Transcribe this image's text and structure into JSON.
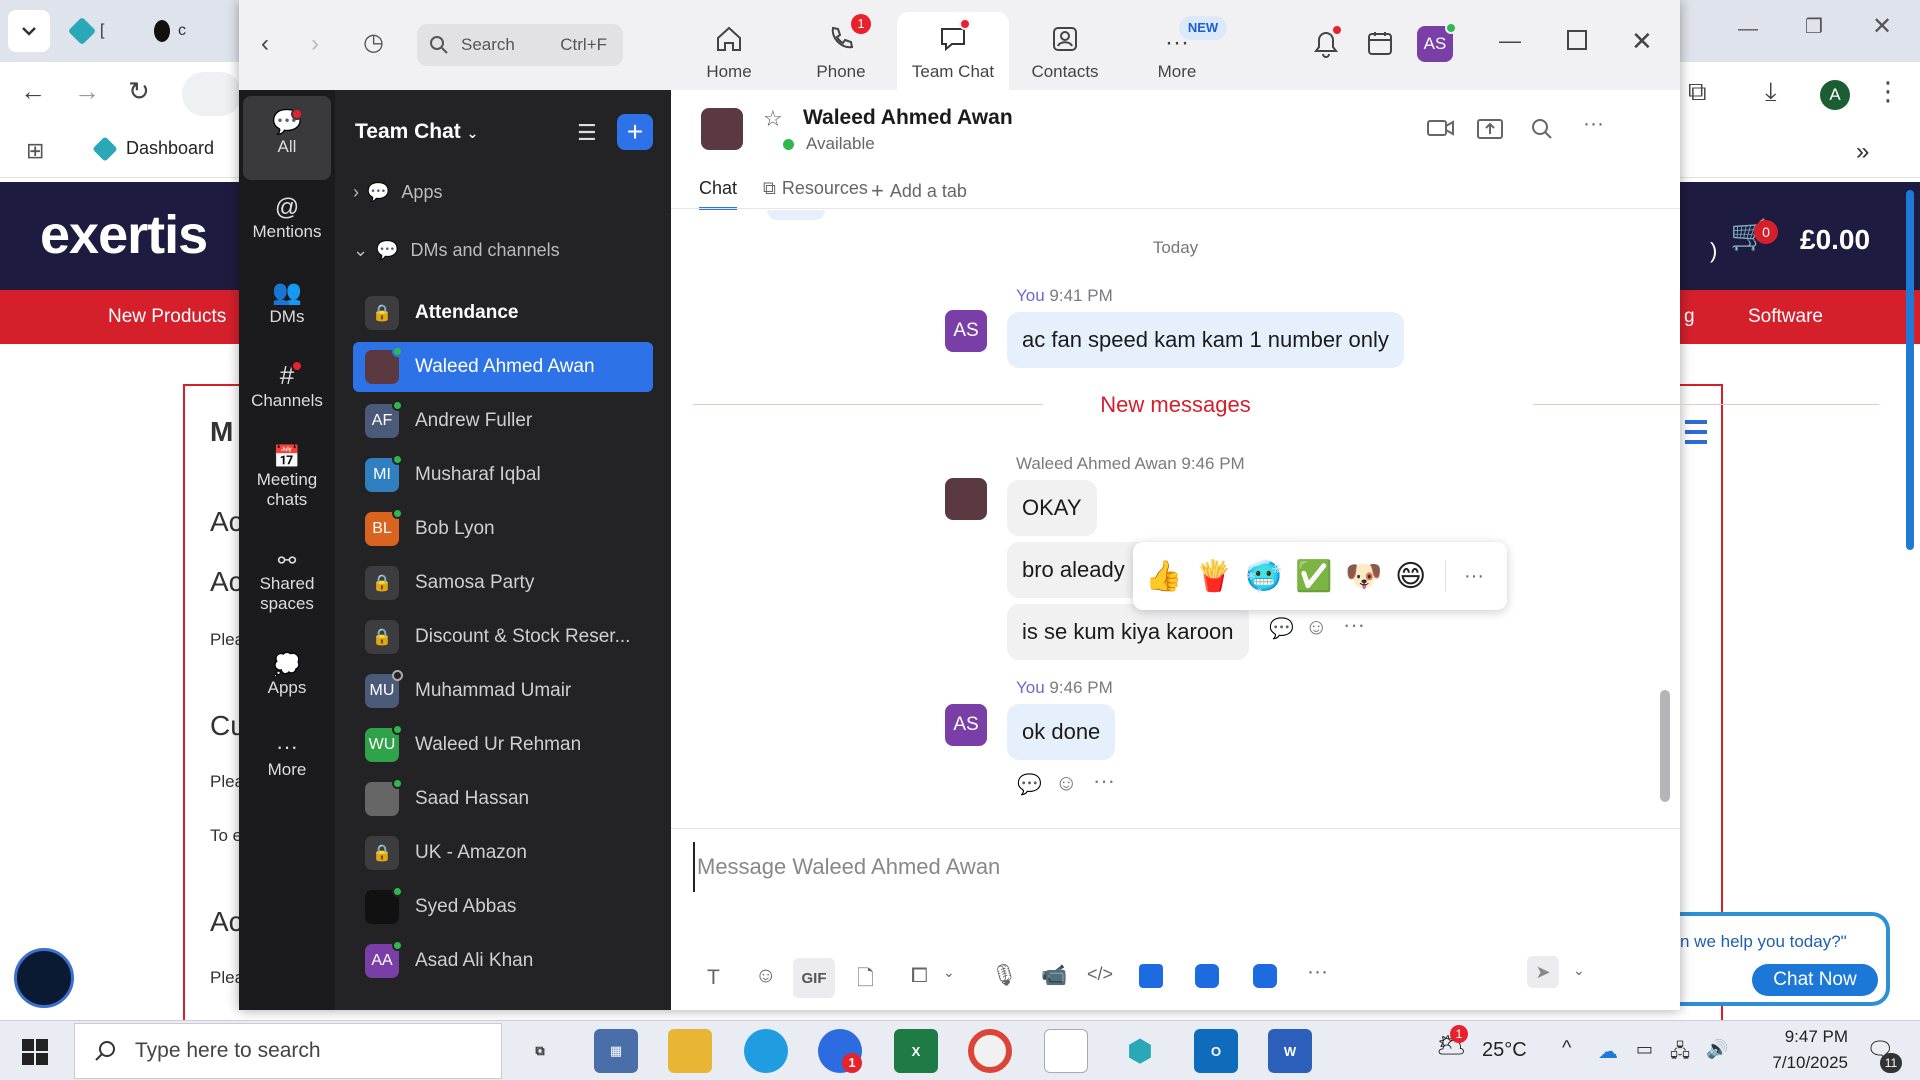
{
  "browser": {
    "tabs": [
      {
        "label": "[",
        "icon": "site-icon"
      },
      {
        "label": "c",
        "icon": "site-icon"
      }
    ],
    "bookmark_dashboard": "Dashboard",
    "profile_initial": "A"
  },
  "site": {
    "brand": "exertis",
    "cart_count": "0",
    "cart_total": "£0.00",
    "nav": [
      "New Products",
      "g",
      "Software"
    ],
    "fragments": [
      "M",
      "Ac",
      "Ac",
      "Plea",
      "Cu",
      "Plea",
      "To e",
      "Ac",
      "Plea"
    ],
    "paren": ")",
    "chat_prompt": "n we help you today?\"",
    "chat_now": "Chat Now"
  },
  "zoom": {
    "search_placeholder": "Search",
    "search_shortcut": "Ctrl+F",
    "tabs": [
      {
        "label": "Home",
        "icon": "home-icon"
      },
      {
        "label": "Phone",
        "icon": "phone-icon",
        "badge": "1"
      },
      {
        "label": "Team Chat",
        "icon": "chat-icon"
      },
      {
        "label": "Contacts",
        "icon": "contacts-icon"
      },
      {
        "label": "More",
        "icon": "more-icon",
        "badge": "NEW"
      }
    ],
    "user_initials": "AS",
    "rail": [
      {
        "label": "All"
      },
      {
        "label": "Mentions"
      },
      {
        "label": "DMs"
      },
      {
        "label": "Channels"
      },
      {
        "label": "Meeting chats"
      },
      {
        "label": "Shared spaces"
      },
      {
        "label": "Apps"
      },
      {
        "label": "More"
      }
    ],
    "sidebar": {
      "title": "Team Chat",
      "sections": [
        "Apps",
        "DMs and channels"
      ],
      "channels": [
        {
          "label": "Attendance",
          "avatar": "",
          "type": "lock",
          "bold": true
        },
        {
          "label": "Waleed Ahmed Awan",
          "avatar": "",
          "type": "photo",
          "active": true
        },
        {
          "label": "Andrew Fuller",
          "avatar": "AF",
          "color": "#4a5a78"
        },
        {
          "label": "Musharaf Iqbal",
          "avatar": "MI",
          "color": "#2f7fc1"
        },
        {
          "label": "Bob Lyon",
          "avatar": "BL",
          "color": "#d9641f"
        },
        {
          "label": "Samosa Party",
          "avatar": "",
          "type": "lock"
        },
        {
          "label": "Discount & Stock Reser...",
          "avatar": "",
          "type": "lock"
        },
        {
          "label": "Muhammad Umair",
          "avatar": "MU",
          "color": "#4a5a78"
        },
        {
          "label": "Waleed Ur Rehman",
          "avatar": "WU",
          "color": "#2fa24a"
        },
        {
          "label": "Saad Hassan",
          "avatar": "",
          "type": "photo"
        },
        {
          "label": "UK - Amazon",
          "avatar": "",
          "type": "lock"
        },
        {
          "label": "Syed Abbas",
          "avatar": "",
          "type": "photo"
        },
        {
          "label": "Asad Ali Khan",
          "avatar": "AA",
          "color": "#7a3fa7"
        }
      ]
    },
    "chat": {
      "contact_name": "Waleed Ahmed Awan",
      "status": "Available",
      "tabs": [
        "Chat",
        "Resources",
        "Add a tab"
      ],
      "date_divider": "Today",
      "new_messages_label": "New messages",
      "messages": [
        {
          "sender": "You",
          "time": "9:41 PM",
          "text": "ac fan speed kam kam 1 number only"
        },
        {
          "sender": "Waleed Ahmed Awan",
          "time": "9:46 PM",
          "lines": [
            "OKAY",
            "bro aleady",
            "is se kum kiya karoon"
          ]
        },
        {
          "sender": "You",
          "time": "9:46 PM",
          "text": "ok done"
        }
      ],
      "reactions": [
        "👍",
        "🍟",
        "🥶",
        "✅",
        "🐶",
        "😄"
      ],
      "composer_placeholder": "Message Waleed Ahmed Awan",
      "toolbar_gif": "GIF"
    }
  },
  "taskbar": {
    "search_placeholder": "Type here to search",
    "weather": "25°C",
    "time": "9:47 PM",
    "date": "7/10/2025",
    "notification_count": "11",
    "zoom_badge": "1",
    "weather_badge": "1"
  }
}
